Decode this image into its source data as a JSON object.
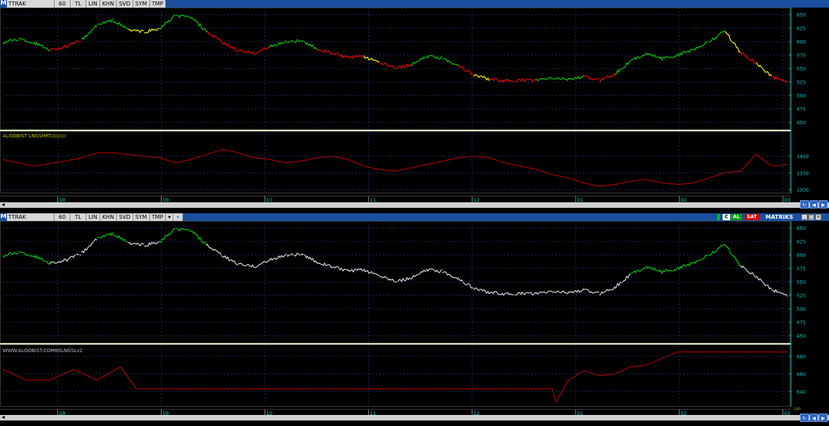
{
  "toolbar": {
    "m_label": "M",
    "symbol": "TTRAK",
    "period": "60",
    "currency": "TL",
    "buttons": [
      "LIN",
      "KHN",
      "SVD",
      "SYM",
      "TMP"
    ]
  },
  "top_chart": {
    "indicator_label": "ALGOBIST LNGSHRT/////////"
  },
  "bottom_chart": {
    "badges": {
      "al": "AL",
      "sat": "SAT",
      "brand": "MATRIKS"
    },
    "indicator_label": "WWW.ALGOBIST.COM60LNGSLv2",
    "scale_mode": "Lin"
  },
  "colors": {
    "up": "#00d000",
    "down": "#ff0000",
    "neutral": "#ffff00",
    "white_line": "#e0e0e0",
    "indicator": "#cc0000",
    "axis_text": "#00c8c8",
    "grid": "#1b2d6b"
  },
  "chart_data": [
    {
      "type": "line",
      "panel": "top-price",
      "x_ticks": [
        "08",
        "09",
        "10",
        "11",
        "12",
        "01",
        "02",
        "03"
      ],
      "y_ticks": [
        650,
        625,
        600,
        575,
        550,
        525,
        500,
        475,
        450
      ],
      "ylim": [
        440,
        658
      ],
      "x": [
        0,
        2,
        4,
        6,
        8,
        10,
        12,
        14,
        16,
        18,
        20,
        22,
        24,
        26,
        28,
        30,
        32,
        34,
        36,
        38,
        40,
        42,
        44,
        46,
        48,
        50,
        52,
        54,
        56,
        58,
        60,
        62,
        64,
        66,
        68,
        70,
        72,
        74,
        76,
        78,
        80,
        82,
        84,
        86,
        88,
        90,
        92,
        94,
        96,
        98,
        100
      ],
      "y": [
        598,
        605,
        598,
        585,
        590,
        602,
        630,
        640,
        622,
        618,
        624,
        648,
        645,
        618,
        598,
        583,
        578,
        590,
        600,
        601,
        587,
        578,
        570,
        572,
        562,
        552,
        556,
        572,
        570,
        556,
        538,
        530,
        527,
        528,
        528,
        532,
        530,
        535,
        528,
        540,
        564,
        578,
        568,
        575,
        585,
        600,
        620,
        580,
        560,
        535,
        525
      ],
      "segments": [
        "up",
        "up",
        "up",
        "down",
        "down",
        "up",
        "up",
        "up",
        "neutral",
        "neutral",
        "up",
        "up",
        "up",
        "down",
        "down",
        "down",
        "down",
        "up",
        "up",
        "up",
        "down",
        "down",
        "down",
        "neutral",
        "down",
        "down",
        "up",
        "up",
        "up",
        "down",
        "neutral",
        "down",
        "down",
        "down",
        "up",
        "up",
        "up",
        "down",
        "down",
        "up",
        "up",
        "up",
        "up",
        "up",
        "up",
        "up",
        "neutral",
        "down",
        "neutral",
        "down",
        "down"
      ],
      "grid": true
    },
    {
      "type": "line",
      "panel": "top-indicator",
      "name": "ALGOBIST LNGSHRT/////////",
      "y_ticks": [
        1400,
        1350,
        1300
      ],
      "ylim": [
        1295,
        1460
      ],
      "x": [
        0,
        2,
        4,
        6,
        8,
        10,
        12,
        14,
        16,
        18,
        20,
        22,
        24,
        26,
        28,
        30,
        32,
        34,
        36,
        38,
        40,
        42,
        44,
        46,
        48,
        50,
        52,
        54,
        56,
        58,
        60,
        62,
        64,
        66,
        68,
        70,
        72,
        74,
        76,
        78,
        80,
        82,
        84,
        86,
        88,
        90,
        92,
        94,
        96,
        98,
        100
      ],
      "y": [
        1390,
        1380,
        1370,
        1378,
        1385,
        1395,
        1410,
        1410,
        1405,
        1400,
        1395,
        1380,
        1390,
        1405,
        1420,
        1410,
        1395,
        1390,
        1380,
        1385,
        1395,
        1400,
        1390,
        1370,
        1360,
        1355,
        1365,
        1375,
        1385,
        1395,
        1400,
        1395,
        1380,
        1370,
        1360,
        1345,
        1335,
        1320,
        1310,
        1315,
        1325,
        1330,
        1320,
        1315,
        1320,
        1335,
        1350,
        1355,
        1405,
        1370,
        1375
      ],
      "grid": true
    },
    {
      "type": "line",
      "panel": "bottom-price",
      "y_ticks": [
        650,
        625,
        600,
        575,
        550,
        525,
        500,
        475,
        450
      ],
      "ylim": [
        440,
        658
      ],
      "x": [
        0,
        2,
        4,
        6,
        8,
        10,
        12,
        14,
        16,
        18,
        20,
        22,
        24,
        26,
        28,
        30,
        32,
        34,
        36,
        38,
        40,
        42,
        44,
        46,
        48,
        50,
        52,
        54,
        56,
        58,
        60,
        62,
        64,
        66,
        68,
        70,
        72,
        74,
        76,
        78,
        80,
        82,
        84,
        86,
        88,
        90,
        92,
        94,
        96,
        98,
        100
      ],
      "y": [
        598,
        605,
        598,
        585,
        590,
        602,
        630,
        640,
        622,
        618,
        624,
        648,
        645,
        618,
        598,
        583,
        578,
        590,
        600,
        601,
        587,
        578,
        570,
        572,
        562,
        552,
        556,
        572,
        570,
        556,
        538,
        530,
        527,
        528,
        528,
        532,
        530,
        535,
        528,
        540,
        564,
        578,
        568,
        575,
        585,
        600,
        620,
        580,
        560,
        535,
        525
      ],
      "segments": [
        "up",
        "up",
        "up",
        "white",
        "white",
        "white",
        "up",
        "up",
        "white",
        "white",
        "up",
        "up",
        "up",
        "white",
        "white",
        "white",
        "white",
        "white",
        "white",
        "white",
        "white",
        "white",
        "white",
        "white",
        "white",
        "white",
        "white",
        "white",
        "white",
        "white",
        "white",
        "white",
        "white",
        "white",
        "white",
        "white",
        "white",
        "white",
        "white",
        "white",
        "up",
        "up",
        "up",
        "up",
        "up",
        "up",
        "up",
        "white",
        "white",
        "white",
        "white"
      ],
      "grid": true
    },
    {
      "type": "line",
      "panel": "bottom-indicator",
      "name": "WWW.ALGOBIST.COM60LNGSLv2",
      "y_ticks": [
        680,
        660,
        640
      ],
      "ylim": [
        625,
        688
      ],
      "x": [
        0,
        3,
        6,
        9,
        12,
        15,
        17,
        70,
        70.5,
        72,
        74,
        76,
        78,
        80,
        82,
        84,
        86,
        100
      ],
      "y": [
        665,
        653,
        653,
        665,
        653,
        668,
        643,
        643,
        628,
        652,
        664,
        658,
        660,
        668,
        670,
        678,
        685,
        685
      ],
      "grid": true
    }
  ]
}
